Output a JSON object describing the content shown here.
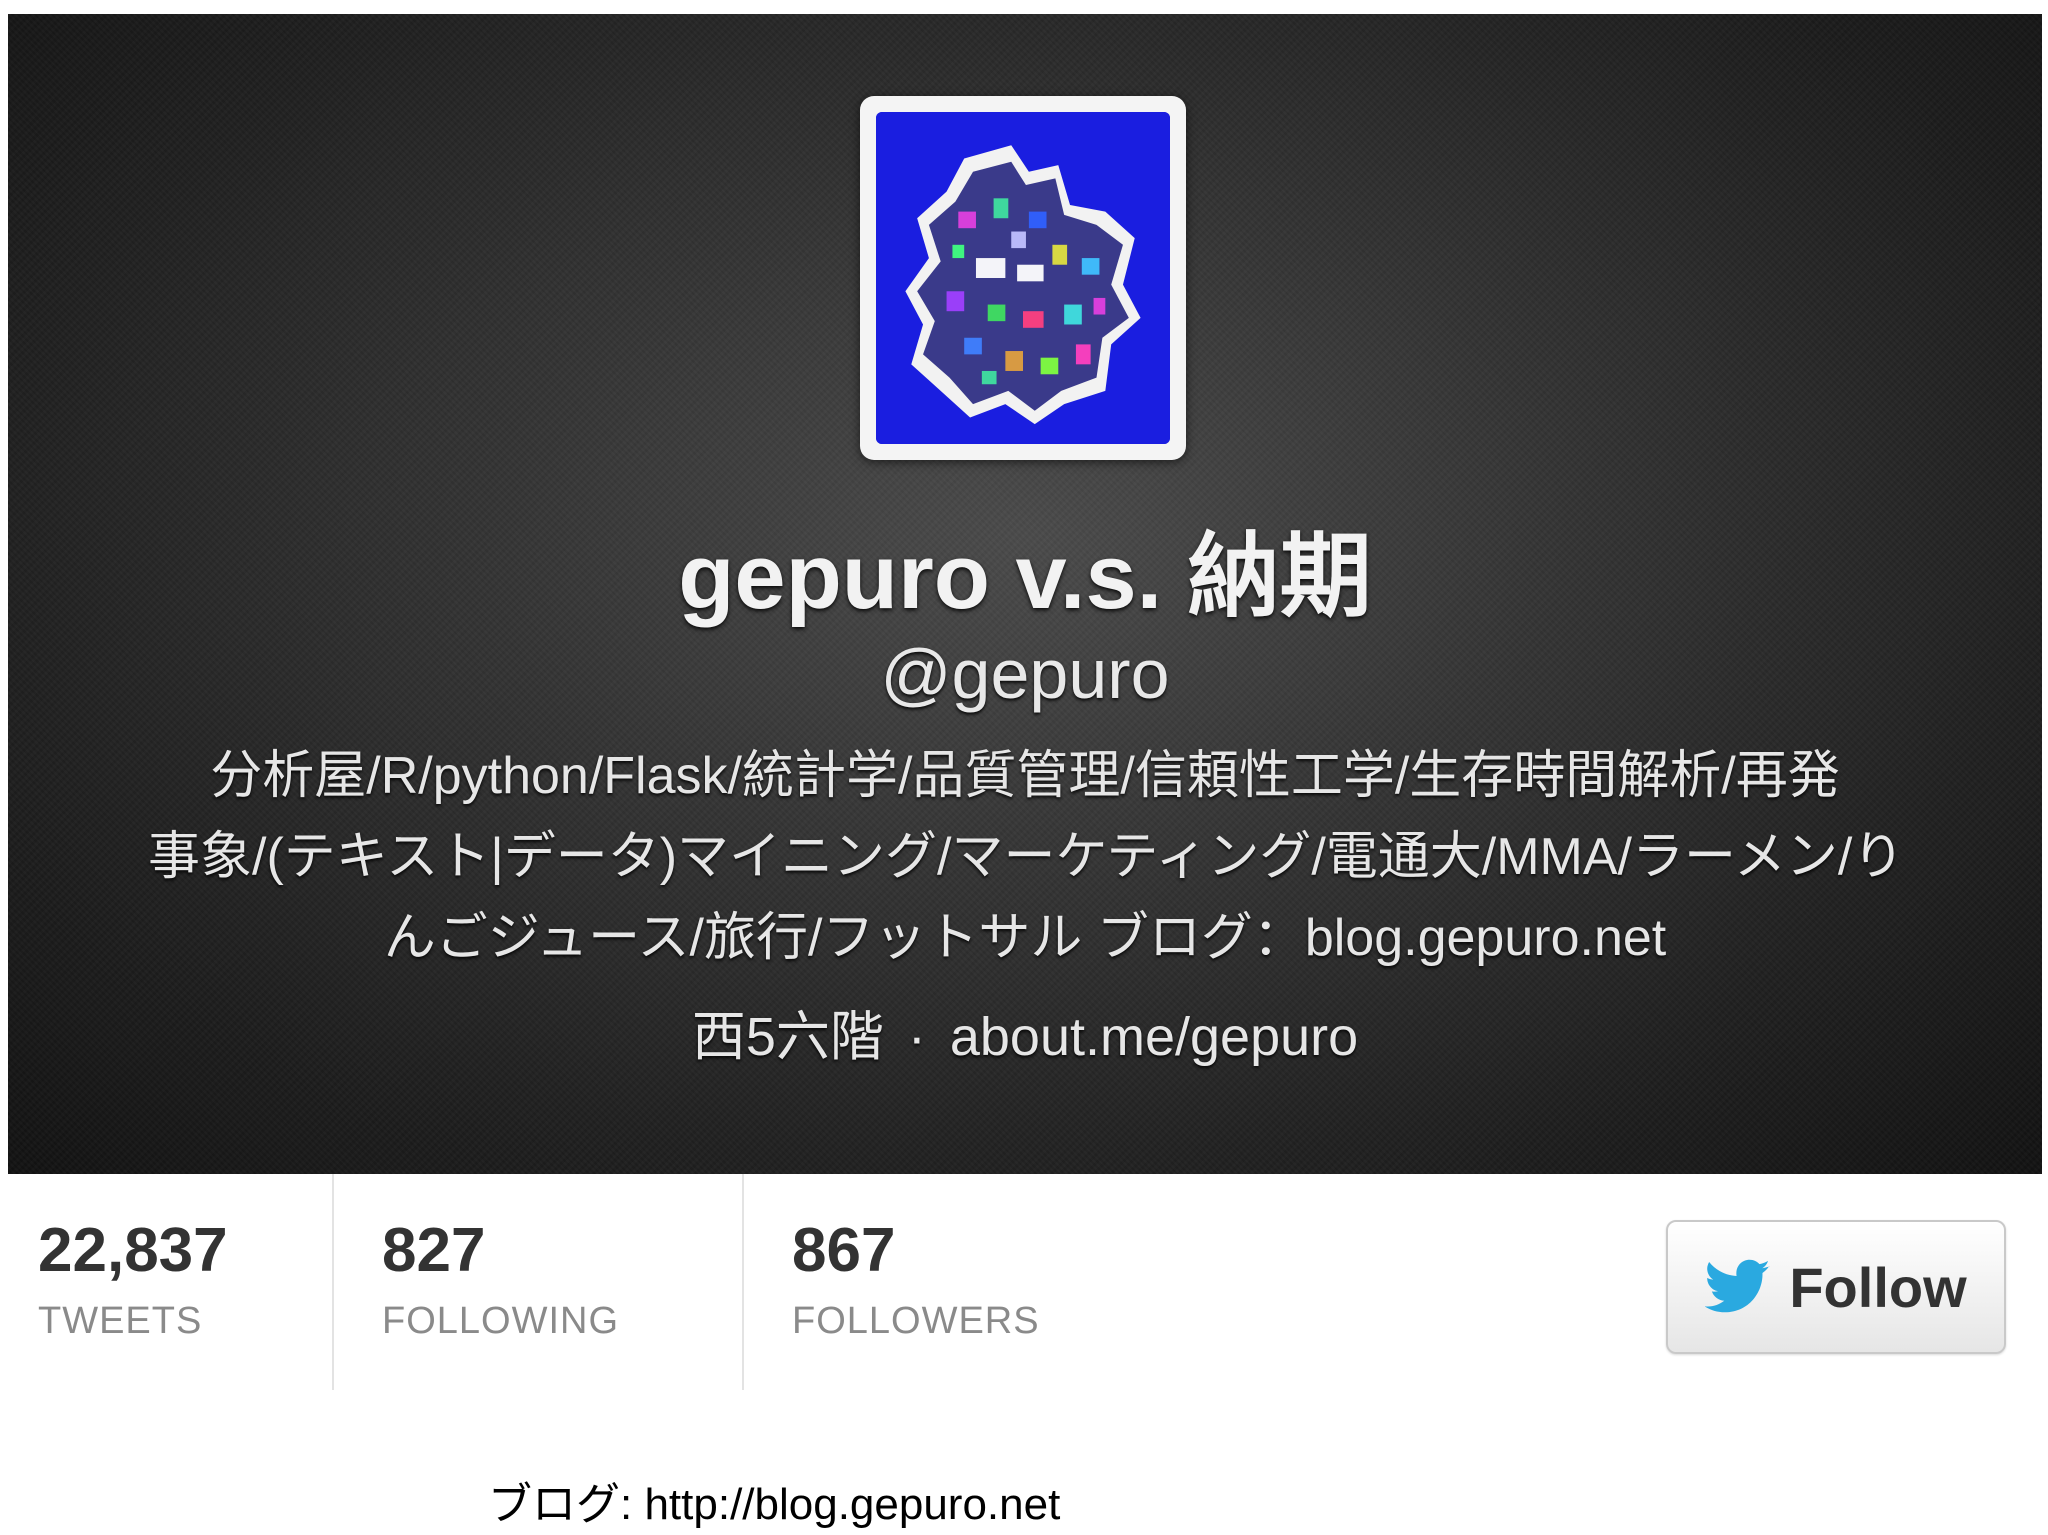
{
  "profile": {
    "display_name": "gepuro v.s. 納期",
    "screen_name": "@gepuro",
    "bio_lines": [
      "分析屋/R/python/Flask/統計学/品質管理/信頼性工学/生存時間解析/再発",
      "事象/(テキスト|データ)マイニング/マーケティング/電通大/MMA/ラーメン/り",
      "んごジュース/旅行/フットサル ブログ：blog.gepuro.net"
    ],
    "location": "西5六階",
    "separator": "·",
    "url": "about.me/gepuro",
    "avatar_icon": "pixel-art-avatar",
    "avatar_bg": "#1a1ee0"
  },
  "stats": {
    "tweets": {
      "value": "22,837",
      "label": "TWEETS"
    },
    "following": {
      "value": "827",
      "label": "FOLLOWING"
    },
    "followers": {
      "value": "867",
      "label": "FOLLOWERS"
    }
  },
  "follow_button": {
    "label": "Follow",
    "icon": "twitter-bird-icon",
    "icon_color": "#2aa9e0"
  },
  "caption": "ブログ: http://blog.gepuro.net"
}
